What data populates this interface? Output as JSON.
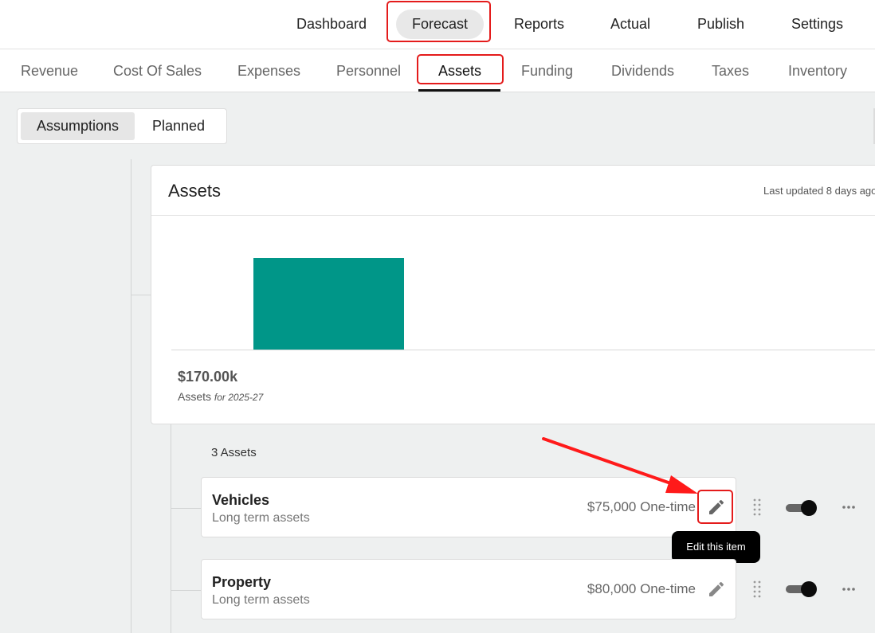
{
  "top_nav": {
    "dashboard": "Dashboard",
    "forecast": "Forecast",
    "reports": "Reports",
    "actual": "Actual",
    "publish": "Publish",
    "settings": "Settings"
  },
  "sub_nav": {
    "revenue": "Revenue",
    "cost_of_sales": "Cost Of Sales",
    "expenses": "Expenses",
    "personnel": "Personnel",
    "assets": "Assets",
    "funding": "Funding",
    "dividends": "Dividends",
    "taxes": "Taxes",
    "inventory": "Inventory"
  },
  "view_toggle": {
    "assumptions": "Assumptions",
    "planned": "Planned"
  },
  "assets_card": {
    "title": "Assets",
    "last_updated": "Last updated 8 days ago",
    "total_value": "$170.00k",
    "total_label": "Assets",
    "total_period": "for 2025-27"
  },
  "chart_data": {
    "type": "bar",
    "bar_color": "#009688",
    "categories": [
      "",
      "",
      "",
      ""
    ],
    "values": [
      170,
      0,
      0,
      0
    ],
    "ylim": [
      0,
      220
    ]
  },
  "asset_list": {
    "count_label": "3 Assets",
    "items": [
      {
        "name": "Vehicles",
        "category": "Long term assets",
        "amount": "$75,000 One-time"
      },
      {
        "name": "Property",
        "category": "Long term assets",
        "amount": "$80,000 One-time"
      }
    ]
  },
  "tooltip": {
    "edit": "Edit this item"
  },
  "colors": {
    "accent_bar": "#009688",
    "highlight": "#e41b1b",
    "arrow": "#ff1a1a"
  },
  "icons": {
    "edit": "pencil-icon",
    "drag": "drag-handle-icon",
    "more": "more-horizontal-icon"
  }
}
